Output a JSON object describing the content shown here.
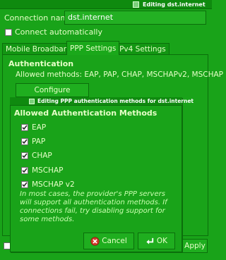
{
  "window": {
    "title": "Editing dst.internet"
  },
  "connection": {
    "name_label": "Connection name:",
    "name_value": "dst.internet",
    "connect_auto_label": "Connect automatically"
  },
  "tabs": [
    {
      "label": "Mobile Broadband"
    },
    {
      "label": "PPP Settings"
    },
    {
      "label": "IPv4 Settings"
    }
  ],
  "ppp": {
    "section_title": "Authentication",
    "allowed_methods": "Allowed methods: EAP, PAP, CHAP, MSCHAPv2, MSCHAP",
    "configure_button": "Configure Methods..."
  },
  "dialog": {
    "title": "Editing PPP authentication methods for dst.internet",
    "heading": "Allowed Authentication Methods",
    "methods": [
      {
        "label": "EAP",
        "checked": true
      },
      {
        "label": "PAP",
        "checked": true
      },
      {
        "label": "CHAP",
        "checked": true
      },
      {
        "label": "MSCHAP",
        "checked": true
      },
      {
        "label": "MSCHAP v2",
        "checked": true
      }
    ],
    "note": "In most cases, the provider's PPP servers will support all authentication methods.  If connections fail, try disabling support for some methods.",
    "cancel_label": "Cancel",
    "ok_label": "OK"
  },
  "footer": {
    "apply_label": "Apply"
  },
  "colors": {
    "background": "#19a319",
    "titlebar": "#0f8a0f",
    "text": "#e6ffc8",
    "border": "#0b6e0b"
  }
}
